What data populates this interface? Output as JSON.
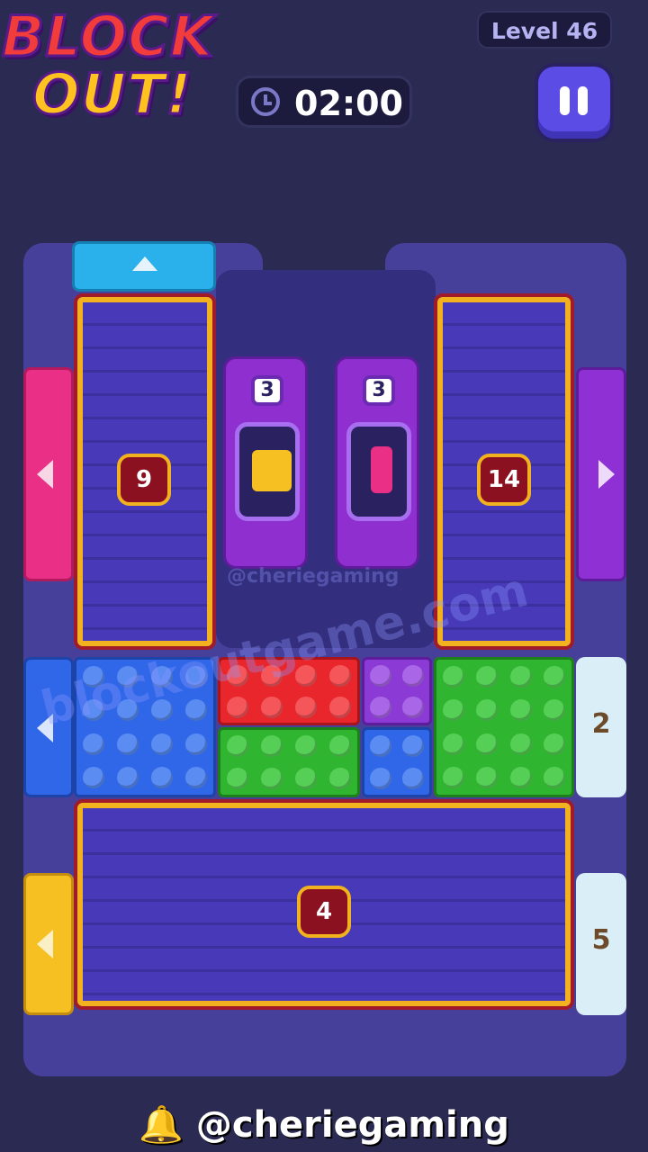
{
  "header": {
    "logo_line1": "BLOCK",
    "logo_line2": "OUT!",
    "timer": "02:00",
    "level": "Level 46",
    "pause_icon": "pause-icon",
    "clock_icon": "clock-icon"
  },
  "board": {
    "left_box_count": "9",
    "right_box_count": "14",
    "bottom_box_count": "4",
    "machine_left_count": "3",
    "machine_right_count": "3",
    "side_counter_top": "2",
    "side_counter_bottom": "5",
    "watermark_center": "@cheriegaming",
    "watermark_diag": "blockoutgame.com"
  },
  "colors": {
    "blue": "#2f67e8",
    "red": "#e8262c",
    "green": "#2fb52f",
    "purple": "#8b3ad6",
    "pink": "#ea2f86",
    "yellow": "#f6c022",
    "cyan": "#2ab0ea",
    "violet": "#8e30d4"
  },
  "footer": {
    "handle": "🔔 @cheriegaming"
  }
}
